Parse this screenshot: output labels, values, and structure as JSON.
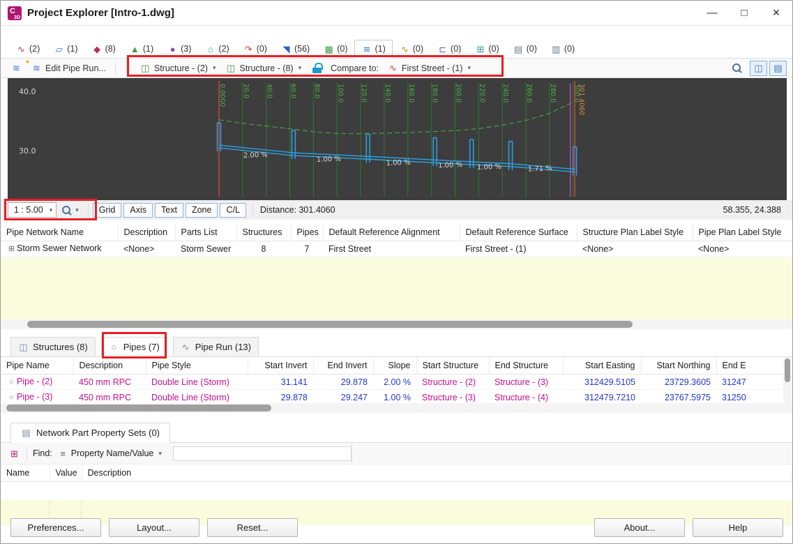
{
  "window": {
    "title": "Project Explorer [Intro-1.dwg]"
  },
  "icons": {
    "app_badge": "C",
    "app_badge_sub": "3D",
    "minimize": "—",
    "maximize": "□",
    "close": "×",
    "dropdown": "▾",
    "new_pipe_run": "≋",
    "new_pipe_run_star": "★",
    "edit_pipe_run": "≋",
    "from_structure": "◫",
    "to_structure": "◫",
    "alignment": "∿",
    "view_toggle_a": "◫",
    "view_toggle_b": "▤",
    "structures_tab": "◫",
    "pipes_tab": "○",
    "pipe_run_tab": "∿",
    "network_row": "⊞",
    "pipe_row": "○",
    "propsets_tab": "▤",
    "find_button": "⊞",
    "find_list": "≡"
  },
  "object_tabs": [
    {
      "count": "(2)",
      "glyph": "∿",
      "color": "#c23b2e"
    },
    {
      "count": "(1)",
      "glyph": "▱",
      "color": "#2d7fc1"
    },
    {
      "count": "(8)",
      "glyph": "◆",
      "color": "#b3345c"
    },
    {
      "count": "(1)",
      "glyph": "▲",
      "color": "#3f9d44"
    },
    {
      "count": "(3)",
      "glyph": "●",
      "color": "#8a55a8"
    },
    {
      "count": "(2)",
      "glyph": "⌂",
      "color": "#2d9d8f"
    },
    {
      "count": "(0)",
      "glyph": "↷",
      "color": "#c23b2e"
    },
    {
      "count": "(56)",
      "glyph": "◥",
      "color": "#2d5fc1"
    },
    {
      "count": "(0)",
      "glyph": "▦",
      "color": "#3f9d44"
    },
    {
      "count": "(1)",
      "glyph": "≋",
      "color": "#2d7fc1",
      "selected": true
    },
    {
      "count": "(0)",
      "glyph": "∿",
      "color": "#d07a2e"
    },
    {
      "count": "(0)",
      "glyph": "⊏",
      "color": "#7a55a8"
    },
    {
      "count": "(0)",
      "glyph": "⊞",
      "color": "#2d9d8f"
    },
    {
      "count": "(0)",
      "glyph": "▤",
      "color": "#6d7a85"
    },
    {
      "count": "(0)",
      "glyph": "▥",
      "color": "#6d7a85"
    }
  ],
  "toolbar": {
    "edit_pipe_run": "Edit Pipe Run...",
    "from_structure": "Structure - (2)",
    "to_structure": "Structure - (8)",
    "compare_label": "Compare to:",
    "compare_value": "First Street - (1)"
  },
  "profile": {
    "statusbar": {
      "scale": "1 : 5.00",
      "toggles": [
        "Grid",
        "Axis",
        "Text",
        "Zone",
        "C/L"
      ],
      "distance": "Distance: 301.4060",
      "coords": "58.355, 24.388"
    },
    "chart_data": {
      "type": "line",
      "station_start": 0,
      "station_end": 301.406,
      "end_station_label": "301.4060",
      "x_ticks": [
        0,
        20,
        40,
        60,
        80,
        100,
        120,
        140,
        160,
        180,
        200,
        220,
        240,
        260,
        280,
        300
      ],
      "x_tick_labels": [
        "0.0000",
        "20.0",
        "40.0",
        "60.0",
        "80.0",
        "100.0",
        "120.0",
        "140.0",
        "160.0",
        "180.0",
        "200.0",
        "220.0",
        "240.0",
        "260.0",
        "280.0",
        "300.0"
      ],
      "y_ticks": [
        40,
        30
      ],
      "y_tick_labels": [
        "40.0",
        "30.0"
      ],
      "ylim": [
        24.388,
        42
      ],
      "grid_color": "#2c7a2c",
      "tick_label_color": "#4fae4f",
      "axis_label_color": "#d6d6d6",
      "boundary_color": "#c44536",
      "compare_color": "#b84fb8",
      "compare_station": 297.6,
      "end_label_color": "#d08a3e",
      "surface": {
        "color": "#43a047",
        "dashed": true,
        "points": [
          [
            0,
            35.2
          ],
          [
            20,
            34.6
          ],
          [
            40,
            34.15
          ],
          [
            60,
            33.7
          ],
          [
            80,
            33.2
          ],
          [
            100,
            32.9
          ],
          [
            120,
            32.85
          ],
          [
            140,
            32.95
          ],
          [
            160,
            33.05
          ],
          [
            180,
            33.2
          ],
          [
            200,
            33.4
          ],
          [
            220,
            33.7
          ],
          [
            240,
            34.3
          ],
          [
            260,
            35.1
          ],
          [
            280,
            36.3
          ],
          [
            301.4,
            38.3
          ]
        ]
      },
      "pipe_color": "#2ba3e8",
      "pipe_profile": [
        [
          0,
          30.94
        ],
        [
          63.2,
          29.64
        ],
        [
          126.3,
          29.03
        ],
        [
          183,
          28.43
        ],
        [
          214,
          28.12
        ],
        [
          247,
          27.8
        ],
        [
          301.4,
          26.87
        ]
      ],
      "structures": [
        [
          0,
          30.94
        ],
        [
          63.2,
          29.64
        ],
        [
          126.3,
          29.03
        ],
        [
          183,
          28.43
        ],
        [
          214,
          28.12
        ],
        [
          247,
          27.8
        ],
        [
          301.4,
          26.87
        ]
      ],
      "slope_labels": [
        {
          "station": 31,
          "elevation": 28.9,
          "text": "2.00 %"
        },
        {
          "station": 93,
          "elevation": 28.2,
          "text": "1.00 %"
        },
        {
          "station": 152,
          "elevation": 27.6,
          "text": "1.00 %"
        },
        {
          "station": 196,
          "elevation": 27.2,
          "text": "1.00 %"
        },
        {
          "station": 229,
          "elevation": 26.9,
          "text": "1.00 %"
        },
        {
          "station": 272,
          "elevation": 26.6,
          "text": "1.71 %"
        }
      ]
    }
  },
  "network_table": {
    "columns": [
      "Pipe Network Name",
      "Description",
      "Parts List",
      "Structures",
      "Pipes",
      "Default Reference Alignment",
      "Default Reference Surface",
      "Structure Plan Label Style",
      "Pipe Plan Label Style"
    ],
    "rows": [
      [
        "Storm Sewer Network",
        "<None>",
        "Storm Sewer",
        "8",
        "7",
        "First Street",
        "First Street - (1)",
        "<None>",
        "<None>"
      ]
    ]
  },
  "detail_tabs": [
    {
      "label": "Structures (8)"
    },
    {
      "label": "Pipes (7)",
      "selected": true
    },
    {
      "label": "Pipe Run (13)"
    }
  ],
  "pipes_table": {
    "columns": [
      "Pipe Name",
      "Description",
      "Pipe Style",
      "Start Invert",
      "End Invert",
      "Slope",
      "Start Structure",
      "End Structure",
      "Start Easting",
      "Start Northing",
      "End E"
    ],
    "rows": [
      [
        "Pipe - (2)",
        "450 mm RPC",
        "Double Line (Storm)",
        "31.141",
        "29.878",
        "2.00 %",
        "Structure - (2)",
        "Structure - (3)",
        "312429.5105",
        "23729.3605",
        "31247"
      ],
      [
        "Pipe - (3)",
        "450 mm RPC",
        "Double Line (Storm)",
        "29.878",
        "29.247",
        "1.00 %",
        "Structure - (3)",
        "Structure - (4)",
        "312479.7210",
        "23767.5975",
        "31250"
      ]
    ]
  },
  "property_sets": {
    "tab": "Network Part Property Sets (0)",
    "find_label": "Find:",
    "mode": "Property Name/Value",
    "search_value": "",
    "columns": [
      "Name",
      "Value",
      "Description"
    ]
  },
  "footer": {
    "buttons": [
      "Preferences...",
      "Layout...",
      "Reset...",
      "About...",
      "Help"
    ]
  },
  "colors": {
    "annotation": "#eb1c24",
    "magenta_text": "#c2108e",
    "blue_text": "#2336c9",
    "empty_area": "#fbfbdd"
  }
}
